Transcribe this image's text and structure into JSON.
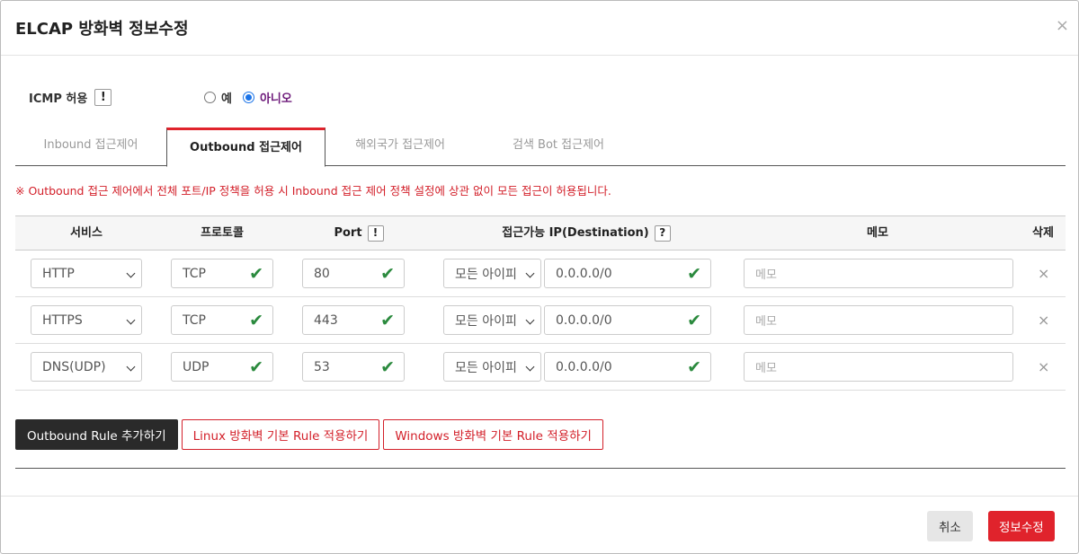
{
  "dialog": {
    "title": "ELCAP 방화벽 정보수정",
    "close_label": "×"
  },
  "icmp": {
    "label": "ICMP 허용",
    "info_glyph": "!",
    "options": [
      "예",
      "아니오"
    ],
    "selected": "아니오"
  },
  "tabs": [
    {
      "label": "Inbound 접근제어",
      "active": false
    },
    {
      "label": "Outbound 접근제어",
      "active": true
    },
    {
      "label": "해외국가 접근제어",
      "active": false
    },
    {
      "label": "검색 Bot 접근제어",
      "active": false
    }
  ],
  "notice": "※ Outbound 접근 제어에서 전체 포트/IP 정책을 허용 시 Inbound 접근 제어 정책 설정에 상관 없이 모든 접근이 허용됩니다.",
  "table": {
    "headers": {
      "service": "서비스",
      "protocol": "프로토콜",
      "port": "Port",
      "port_info": "!",
      "dest": "접근가능 IP(Destination)",
      "dest_info": "?",
      "memo": "메모",
      "delete": "삭제"
    },
    "rows": [
      {
        "service": "HTTP",
        "protocol": "TCP",
        "port": "80",
        "ip_type": "모든 아이피",
        "ip": "0.0.0.0/0",
        "memo_placeholder": "메모"
      },
      {
        "service": "HTTPS",
        "protocol": "TCP",
        "port": "443",
        "ip_type": "모든 아이피",
        "ip": "0.0.0.0/0",
        "memo_placeholder": "메모"
      },
      {
        "service": "DNS(UDP)",
        "protocol": "UDP",
        "port": "53",
        "ip_type": "모든 아이피",
        "ip": "0.0.0.0/0",
        "memo_placeholder": "메모"
      }
    ],
    "check_glyph": "✔",
    "delete_glyph": "×"
  },
  "actions": {
    "add_rule": "Outbound Rule 추가하기",
    "linux_default": "Linux 방화벽 기본 Rule 적용하기",
    "windows_default": "Windows 방화벽 기본 Rule 적용하기"
  },
  "footer": {
    "cancel": "취소",
    "save": "정보수정"
  },
  "colors": {
    "accent_red": "#e0232c",
    "valid_green": "#2b8a3e",
    "radio_blue": "#1a73e8",
    "selected_label": "#6d1a7a"
  }
}
